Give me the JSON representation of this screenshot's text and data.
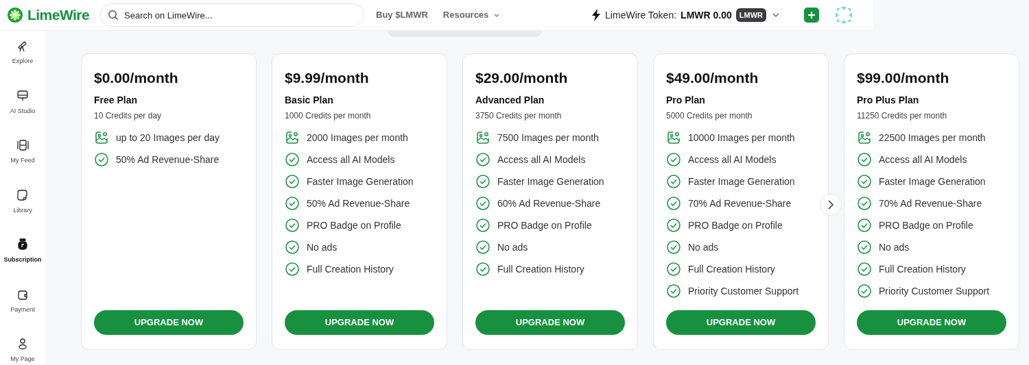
{
  "header": {
    "logo": "LimeWire",
    "search": {
      "placeholder": "Search on LimeWire..."
    },
    "nav": [
      {
        "label": "Buy $LMWR",
        "dropdown": false
      },
      {
        "label": "Resources",
        "dropdown": true
      }
    ],
    "token": {
      "label": "LimeWire Token:",
      "value": "LMWR 0.00",
      "badge": "LMWR"
    }
  },
  "sidebar": {
    "items": [
      {
        "label": "Explore",
        "selected": false
      },
      {
        "label": "AI Studio",
        "selected": false
      },
      {
        "label": "My Feed",
        "selected": false
      },
      {
        "label": "Library",
        "selected": false
      },
      {
        "label": "Subscription",
        "selected": true
      },
      {
        "label": "Payment",
        "selected": false
      },
      {
        "label": "My Page",
        "selected": false
      }
    ]
  },
  "plans": [
    {
      "price": "$0.00/month",
      "name": "Free Plan",
      "credits": "10 Credits per day",
      "features": [
        {
          "kind": "images",
          "text": "up to 20 Images per day"
        },
        {
          "kind": "check",
          "text": "50% Ad Revenue-Share"
        }
      ],
      "button": "UPGRADE NOW"
    },
    {
      "price": "$9.99/month",
      "name": "Basic Plan",
      "credits": "1000 Credits per month",
      "features": [
        {
          "kind": "images",
          "text": "2000 Images per month"
        },
        {
          "kind": "check",
          "text": "Access all AI Models"
        },
        {
          "kind": "check",
          "text": "Faster Image Generation"
        },
        {
          "kind": "check",
          "text": "50% Ad Revenue-Share"
        },
        {
          "kind": "check",
          "text": "PRO Badge on Profile"
        },
        {
          "kind": "check",
          "text": "No ads"
        },
        {
          "kind": "check",
          "text": "Full Creation History"
        }
      ],
      "button": "UPGRADE NOW"
    },
    {
      "price": "$29.00/month",
      "name": "Advanced Plan",
      "credits": "3750 Credits per month",
      "features": [
        {
          "kind": "images",
          "text": "7500 Images per month"
        },
        {
          "kind": "check",
          "text": "Access all AI Models"
        },
        {
          "kind": "check",
          "text": "Faster Image Generation"
        },
        {
          "kind": "check",
          "text": "60% Ad Revenue-Share"
        },
        {
          "kind": "check",
          "text": "PRO Badge on Profile"
        },
        {
          "kind": "check",
          "text": "No ads"
        },
        {
          "kind": "check",
          "text": "Full Creation History"
        }
      ],
      "button": "UPGRADE NOW"
    },
    {
      "price": "$49.00/month",
      "name": "Pro Plan",
      "credits": "5000 Credits per month",
      "features": [
        {
          "kind": "images",
          "text": "10000 Images per month"
        },
        {
          "kind": "check",
          "text": "Access all AI Models"
        },
        {
          "kind": "check",
          "text": "Faster Image Generation"
        },
        {
          "kind": "check",
          "text": "70% Ad Revenue-Share"
        },
        {
          "kind": "check",
          "text": "PRO Badge on Profile"
        },
        {
          "kind": "check",
          "text": "No ads"
        },
        {
          "kind": "check",
          "text": "Full Creation History"
        },
        {
          "kind": "check",
          "text": "Priority Customer Support"
        }
      ],
      "button": "UPGRADE NOW"
    },
    {
      "price": "$99.00/month",
      "name": "Pro Plus Plan",
      "credits": "11250 Credits per month",
      "features": [
        {
          "kind": "images",
          "text": "22500 Images per month"
        },
        {
          "kind": "check",
          "text": "Access all AI Models"
        },
        {
          "kind": "check",
          "text": "Faster Image Generation"
        },
        {
          "kind": "check",
          "text": "70% Ad Revenue-Share"
        },
        {
          "kind": "check",
          "text": "PRO Badge on Profile"
        },
        {
          "kind": "check",
          "text": "No ads"
        },
        {
          "kind": "check",
          "text": "Full Creation History"
        },
        {
          "kind": "check",
          "text": "Priority Customer Support"
        }
      ],
      "button": "UPGRADE NOW"
    }
  ]
}
